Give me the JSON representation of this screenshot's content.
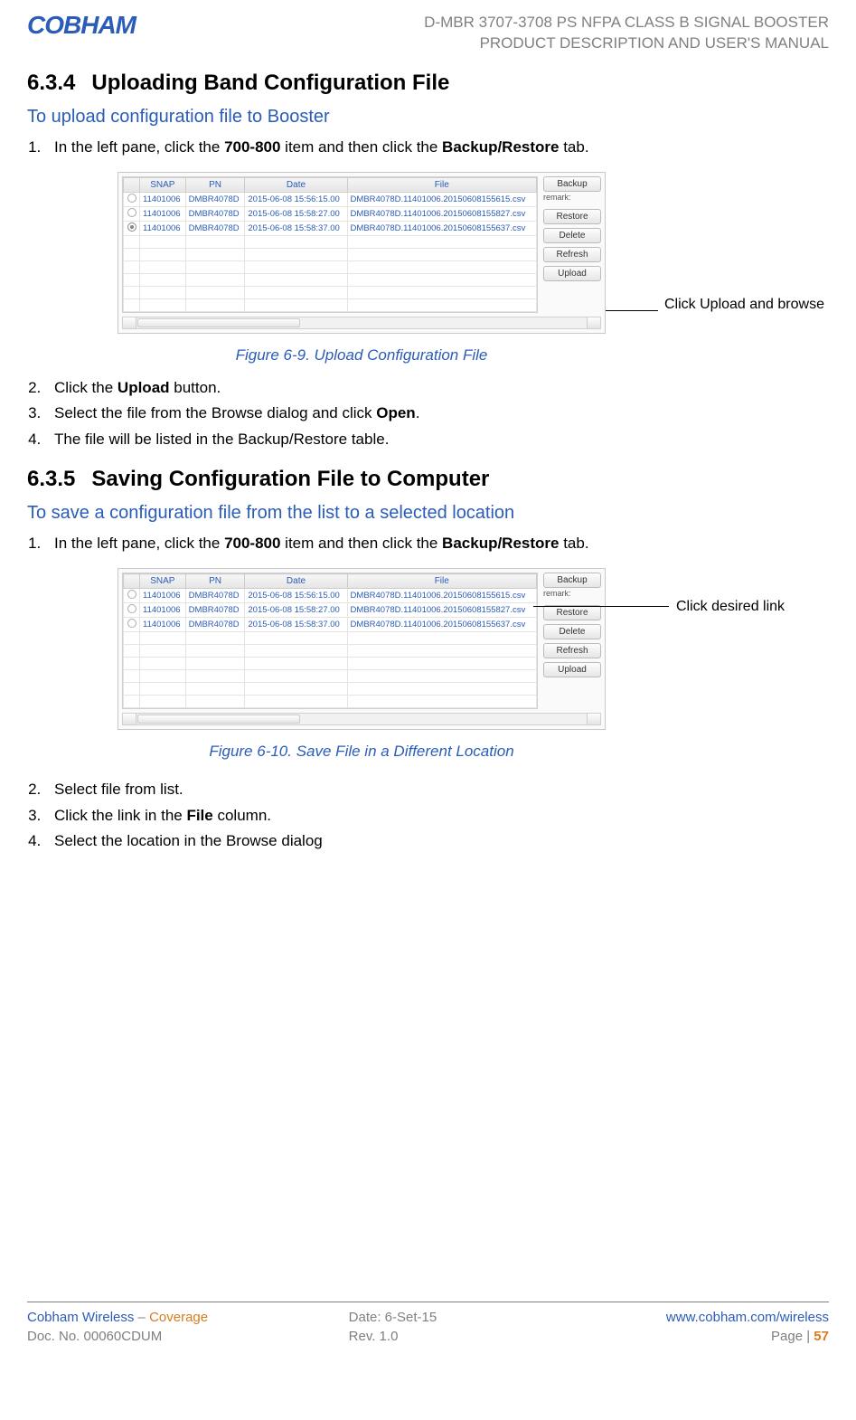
{
  "header": {
    "logo_text": "COBHAM",
    "title_line1": "D-MBR 3707-3708 PS NFPA CLASS B SIGNAL BOOSTER",
    "title_line2": "PRODUCT DESCRIPTION AND USER'S MANUAL"
  },
  "sections": {
    "s1": {
      "number": "6.3.4",
      "title": "Uploading Band Configuration File",
      "blue": "To upload configuration file to Booster",
      "step1_a": "In the left pane, click the ",
      "step1_b": "700-800",
      "step1_c": " item and then click the ",
      "step1_d": "Backup/Restore",
      "step1_e": " tab.",
      "caption": "Figure 6-9. Upload Configuration File",
      "callout": "Click Upload and browse",
      "step2_a": "Click the ",
      "step2_b": "Upload",
      "step2_c": " button.",
      "step3_a": "Select the file from the Browse dialog and click ",
      "step3_b": "Open",
      "step3_c": ".",
      "step4": "The file will be listed in the Backup/Restore table."
    },
    "s2": {
      "number": "6.3.5",
      "title": "Saving Configuration File to Computer",
      "blue": "To save a configuration file from the list to a selected location",
      "step1_a": "In the left pane, click the ",
      "step1_b": "700-800",
      "step1_c": " item and then click the ",
      "step1_d": "Backup/Restore",
      "step1_e": " tab.",
      "caption": "Figure 6-10. Save File in a Different Location",
      "callout": "Click desired link",
      "step2": "Select file from list.",
      "step3_a": "Click the link in the ",
      "step3_b": "File",
      "step3_c": " column.",
      "step4": "Select the location in the Browse dialog"
    }
  },
  "mini_table": {
    "headers": {
      "radio": "",
      "snap": "SNAP",
      "pn": "PN",
      "date": "Date",
      "file": "File"
    },
    "rows": [
      {
        "selected": false,
        "snap": "11401006",
        "pn": "DMBR4078D",
        "date": "2015-06-08 15:56:15.00",
        "file": "DMBR4078D.11401006.20150608155615.csv"
      },
      {
        "selected": false,
        "snap": "11401006",
        "pn": "DMBR4078D",
        "date": "2015-06-08 15:58:27.00",
        "file": "DMBR4078D.11401006.20150608155827.csv"
      },
      {
        "selected": true,
        "snap": "11401006",
        "pn": "DMBR4078D",
        "date": "2015-06-08 15:58:37.00",
        "file": "DMBR4078D.11401006.20150608155637.csv"
      }
    ],
    "buttons": {
      "backup": "Backup",
      "remark": "remark:",
      "restore": "Restore",
      "delete": "Delete",
      "refresh": "Refresh",
      "upload": "Upload"
    }
  },
  "footer": {
    "row1": {
      "left_a": "Cobham Wireless",
      "left_b": " – ",
      "left_c": "Coverage",
      "center": "Date: 6-Set-15",
      "right": "www.cobham.com/wireless"
    },
    "row2": {
      "left": "Doc. No. 00060CDUM",
      "center": "Rev. 1.0",
      "right_a": "Page | ",
      "right_b": "57"
    }
  }
}
